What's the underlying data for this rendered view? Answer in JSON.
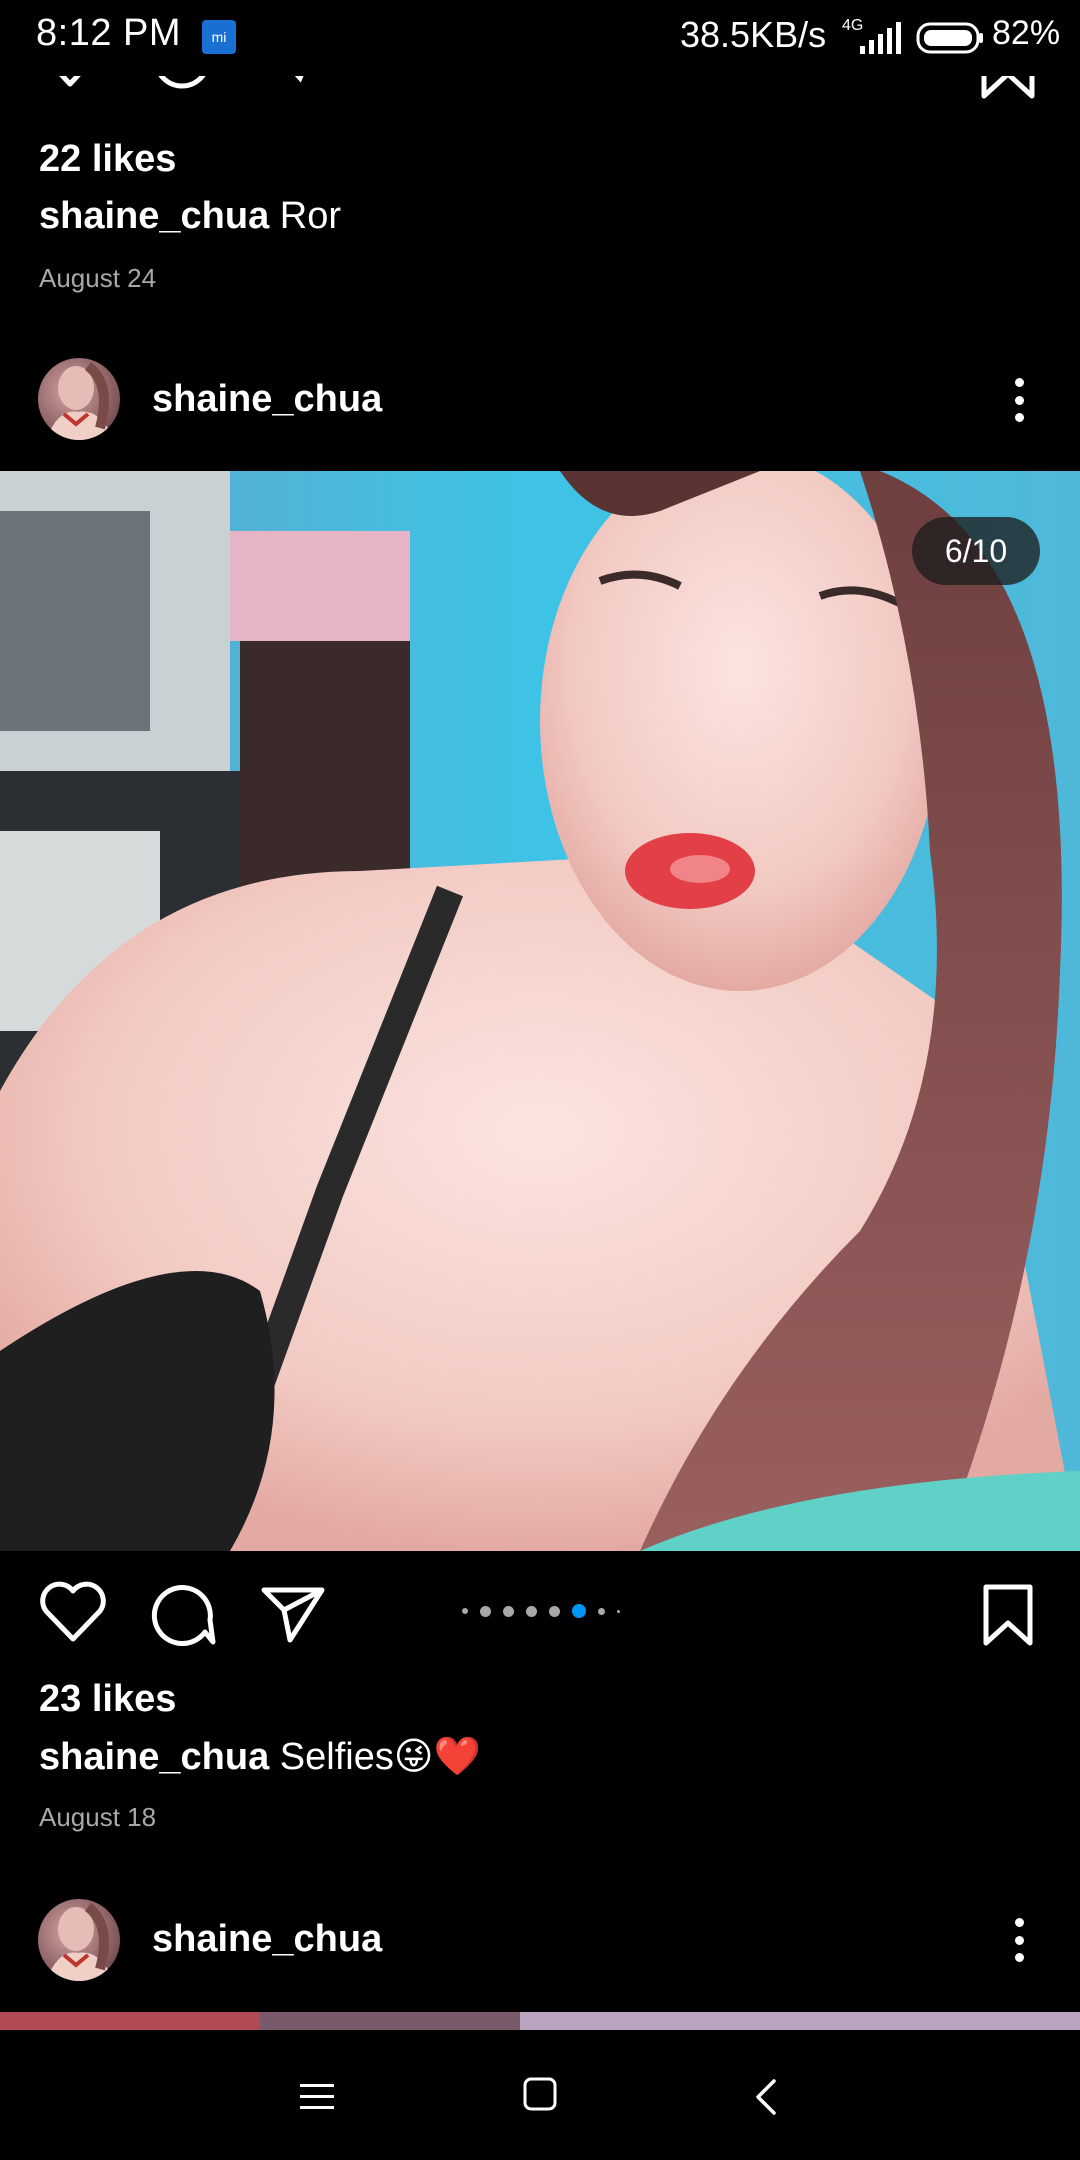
{
  "status_bar": {
    "time": "8:12  PM",
    "speed": "38.5KB/s",
    "network": "4G",
    "battery": "82%"
  },
  "previous_post": {
    "likes": "22 likes",
    "username": "shaine_chua",
    "caption": "Ror",
    "date": "August 24"
  },
  "current_post": {
    "username": "shaine_chua",
    "counter": "6/10",
    "carousel": {
      "current": 6,
      "total": 10
    },
    "likes": "23 likes",
    "caption_user": "shaine_chua",
    "caption": "Selfies😜❤️",
    "date": "August 18"
  },
  "next_post": {
    "username": "shaine_chua"
  },
  "icons": [
    "heart-icon",
    "comment-icon",
    "share-icon",
    "bookmark-icon",
    "more-options-icon",
    "menu-icon",
    "home-square-icon",
    "back-icon"
  ],
  "colors": {
    "background": "#000000",
    "accent_dot": "#0095f6",
    "secondary_text": "#a8a8a8"
  }
}
